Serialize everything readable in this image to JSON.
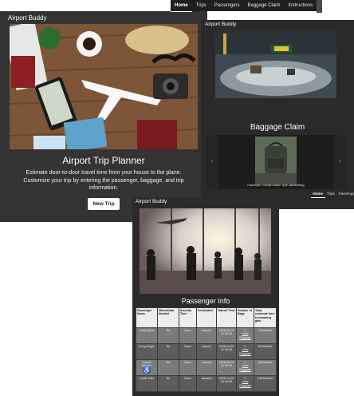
{
  "nav": {
    "items": [
      {
        "label": "Home",
        "active": true
      },
      {
        "label": "Trips",
        "active": false
      },
      {
        "label": "Passengers",
        "active": false
      },
      {
        "label": "Baggage Claim",
        "active": false
      },
      {
        "label": "Instructions",
        "active": false
      }
    ]
  },
  "home": {
    "brand": "Airport Buddy",
    "title": "Airport Trip Planner",
    "description": "Estimate door-to-door travel time from your house to the plane. Customize your trip by entering the passenger, baggage, and trip information.",
    "button_label": "New Trip"
  },
  "baggage": {
    "brand": "Airport Buddy",
    "title": "Baggage Claim",
    "caption": "Passenger: George Wilson Type: (Backs/Bag)",
    "prev_icon": "chevron-left-icon",
    "next_icon": "chevron-right-icon",
    "subnav": [
      {
        "label": "Home",
        "active": true
      },
      {
        "label": "Trips",
        "active": false
      },
      {
        "label": "Passengers",
        "active": false
      }
    ]
  },
  "passengers": {
    "brand": "Airport Buddy",
    "title": "Passenger Info",
    "columns": [
      "Passenger Name",
      "Wheelchair Needed",
      "Security Time",
      "Destination",
      "Takeoff Time",
      "Number of Bags",
      "Total commute time to boarding gate"
    ],
    "rows": [
      {
        "name": "Chad Spiker",
        "wheelchair": "No",
        "security": "None",
        "destination": "Cancun",
        "takeoff": "2025-04-25 01:30:00",
        "bags": "1",
        "bags_link": "View Baggage",
        "total": "72 Minutes"
      },
      {
        "name": "Doug Wright",
        "wheelchair": "No",
        "security": "None",
        "destination": "Cancun",
        "takeoff": "2025-04-09 01:30:00",
        "bags": "1",
        "bags_link": "View Baggage",
        "total": "68 Minutes"
      },
      {
        "name": "Francis Mitchel",
        "wheelchair": "Yes",
        "security": "None",
        "destination": "Cancun",
        "takeoff": "2025-04-24 01:30:00",
        "bags": "1",
        "bags_link": "View Baggage",
        "total": "68 Minutes"
      },
      {
        "name": "Cindie Ellis",
        "wheelchair": "No",
        "security": "None",
        "destination": "Jamaica",
        "takeoff": "2025-04-09 16:30:00",
        "bags": "3",
        "bags_link": "View Baggage",
        "total": "108 Minutes"
      }
    ],
    "wheelchair_icon": "wheelchair-icon"
  }
}
